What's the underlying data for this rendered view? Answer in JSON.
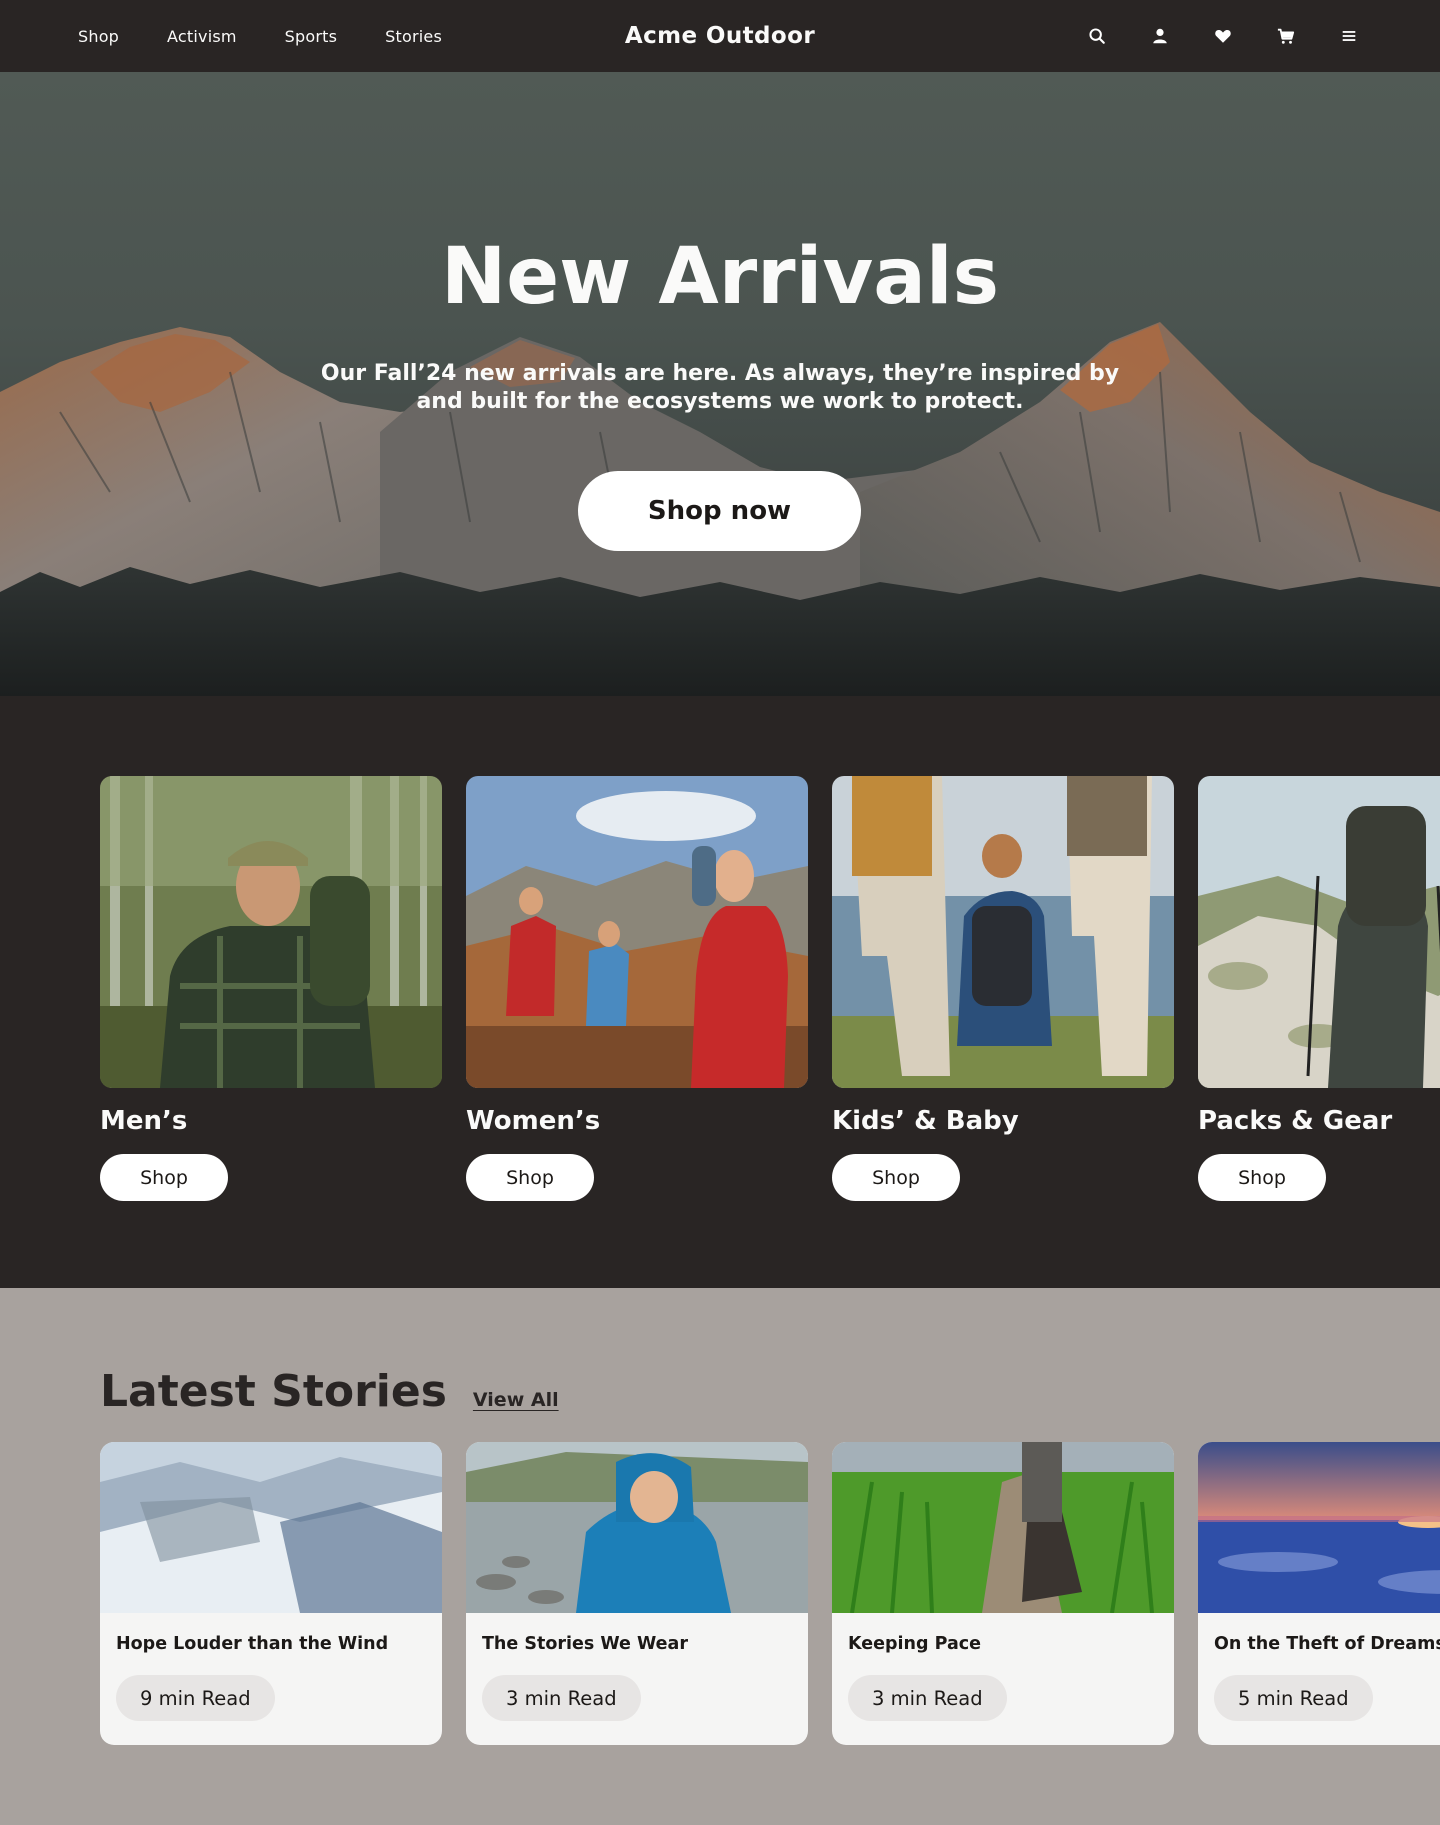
{
  "nav": {
    "links": [
      "Shop",
      "Activism",
      "Sports",
      "Stories"
    ],
    "brand": "Acme Outdoor",
    "icons": [
      "search-icon",
      "account-icon",
      "heart-icon",
      "cart-icon",
      "menu-icon"
    ]
  },
  "hero": {
    "title": "New Arrivals",
    "subtitle": "Our Fall’24 new arrivals are here. As always, they’re inspired by and built for the ecosystems we work to protect.",
    "button": "Shop now"
  },
  "categories": [
    {
      "name": "Men’s",
      "button": "Shop"
    },
    {
      "name": "Women’s",
      "button": "Shop"
    },
    {
      "name": "Kids’ & Baby",
      "button": "Shop"
    },
    {
      "name": "Packs & Gear",
      "button": "Shop"
    }
  ],
  "stories": {
    "title": "Latest Stories",
    "view_all": "View All",
    "items": [
      {
        "title": "Hope Louder than the Wind",
        "read": "9 min Read"
      },
      {
        "title": "The Stories We Wear",
        "read": "3 min Read"
      },
      {
        "title": "Keeping Pace",
        "read": "3 min Read"
      },
      {
        "title": "On the Theft of Dreams",
        "read": "5 min Read"
      }
    ]
  },
  "colors": {
    "nav_bg": "#292524",
    "category_bg": "#292524",
    "stories_bg": "#a8a29e",
    "button_bg": "#ffffff",
    "card_bg": "#f5f5f4"
  }
}
